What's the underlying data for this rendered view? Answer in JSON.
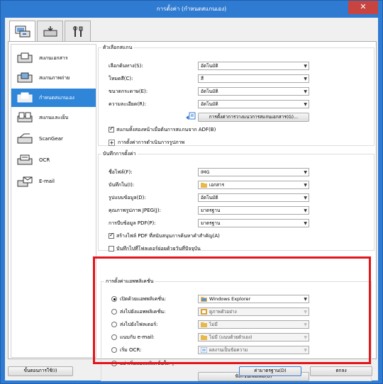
{
  "window": {
    "title": "การตั้งค่า (กำหนดสแกนเอง)",
    "close_label": "✕"
  },
  "tabs": [
    {
      "name": "scan-tab",
      "icon": "scanner-computer-icon",
      "active": true
    },
    {
      "name": "save-tab",
      "icon": "scanner-download-icon",
      "active": false
    },
    {
      "name": "general-tab",
      "icon": "tools-icon",
      "active": false
    }
  ],
  "sidebar": {
    "items": [
      {
        "label": "สแกนเอกสาร",
        "icon": "document-scan-icon",
        "selected": false
      },
      {
        "label": "สแกนภาพถ่าย",
        "icon": "photo-scan-icon",
        "selected": false
      },
      {
        "label": "กำหนดสแกนเอง",
        "icon": "custom-scan-icon",
        "selected": true
      },
      {
        "label": "สแกนและเย็บ",
        "icon": "scan-stitch-icon",
        "selected": false
      },
      {
        "label": "ScanGear",
        "icon": "scangear-icon",
        "selected": false
      },
      {
        "label": "OCR",
        "icon": "ocr-icon",
        "selected": false
      },
      {
        "label": "E-mail",
        "icon": "email-icon",
        "selected": false
      }
    ]
  },
  "scan_options": {
    "legend": "ตัวเลือกสแกน",
    "rows": [
      {
        "label": "เลือกต้นทาง(S):",
        "value": "อัตโนมัติ"
      },
      {
        "label": "โหมดสี(C):",
        "value": "สี"
      },
      {
        "label": "ขนาดกระดาษ(E):",
        "value": "อัตโนมัติ"
      },
      {
        "label": "ความละเอียด(R):",
        "value": "อัตโนมัติ"
      }
    ],
    "driver_button": "การตั้งค่าการวางแนวการสแกนเอกสาร(G)...",
    "adf_checkbox": "สแกนทั้งสองหน้าเมื่อต้นการสแกนจาก ADF(B)",
    "adf_checked": true,
    "image_processing_toggle": "+",
    "image_processing_label": "การตั้งค่าการดำเนินการรูปภาพ"
  },
  "save_settings": {
    "legend": "บันทึกการตั้งค่า",
    "filename_label": "ชื่อไฟล์(F):",
    "filename_value": "IMG",
    "savein_label": "บันทึกใน(I):",
    "savein_value": "เอกสาร",
    "format_label": "รูปแบบข้อมูล(D):",
    "format_value": "อัตโนมัติ",
    "jpeg_label": "คุณภาพรูปภาพ JPEG(J):",
    "jpeg_value": "มาตรฐาน",
    "pdf_label": "การบีบข้อมูล PDF(P):",
    "pdf_value": "มาตรฐาน",
    "pdf_keyword_checkbox": "สร้างไฟล์ PDF ที่สนับสนุนการค้นหาคำสำคัญ(A)",
    "pdf_keyword_checked": true,
    "subfolder_checkbox": "บันทึกไปที่โฟลเดอร์ย่อยด้วยวันที่ปัจจุบัน",
    "subfolder_checked": false
  },
  "app_settings": {
    "legend": "การตั้งค่าแอพพลิเคชั่น",
    "rows": [
      {
        "label": "เปิดด้วยแอพพลิเคชั่น:",
        "value": "Windows Explorer",
        "checked": true,
        "disabled": false,
        "icon": "explorer-icon"
      },
      {
        "label": "ส่งไปยังแอพพลิเคชั่น:",
        "value": "ดูภาพตัวอย่าง",
        "checked": false,
        "disabled": true,
        "icon": "preview-icon"
      },
      {
        "label": "ส่งไปยังโฟลเดอร์:",
        "value": "ไม่มี",
        "checked": false,
        "disabled": true,
        "icon": "folder-icon"
      },
      {
        "label": "แนบกับ e-mail:",
        "value": "ไม่มี (แนบด้วยตัวเอง)",
        "checked": false,
        "disabled": true,
        "icon": "folder-icon"
      },
      {
        "label": "เริ่ม OCR:",
        "value": "ผลงานเป็นข้อความ",
        "checked": false,
        "disabled": true,
        "icon": "ocr-output-icon"
      }
    ],
    "no_launch_label": "อย่าเริ่มแอพพลิเคชั่นใด ๆ",
    "more_functions_button": "ฟังก์ชั่นเพิ่มเติม(U)"
  },
  "footer": {
    "instructions_button": "ขั้นตอนการใช้(I)",
    "defaults_button": "ค่ามาตรฐาน(D)",
    "ok_button": "ตกลง"
  }
}
